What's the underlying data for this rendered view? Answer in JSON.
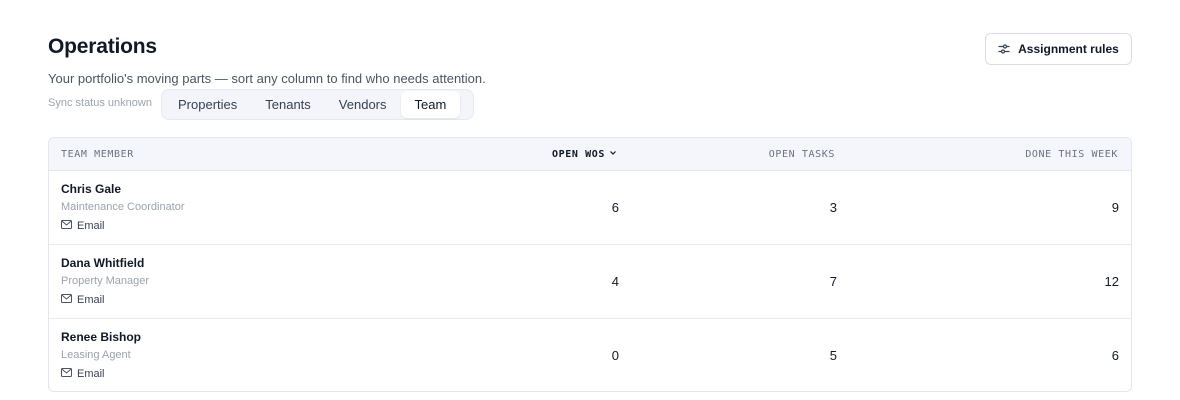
{
  "header": {
    "title": "Operations",
    "subtitle": "Your portfolio's moving parts — sort any column to find who needs attention.",
    "sync_status": "Sync status unknown",
    "rules_button": "Assignment rules",
    "rules_icon": "sliders-icon"
  },
  "tabs": [
    {
      "label": "Properties",
      "active": false
    },
    {
      "label": "Tenants",
      "active": false
    },
    {
      "label": "Vendors",
      "active": false
    },
    {
      "label": "Team",
      "active": true
    }
  ],
  "table": {
    "columns": {
      "member": "TEAM MEMBER",
      "open_wos": "OPEN WOS",
      "open_tasks": "OPEN TASKS",
      "done_this_week": "DONE THIS WEEK"
    },
    "sorted_by": "open_wos",
    "rows": [
      {
        "name": "Chris Gale",
        "role": "Maintenance Coordinator",
        "email_label": "Email",
        "open_wos": "6",
        "open_tasks": "3",
        "done_this_week": "9"
      },
      {
        "name": "Dana Whitfield",
        "role": "Property Manager",
        "email_label": "Email",
        "open_wos": "4",
        "open_tasks": "7",
        "done_this_week": "12"
      },
      {
        "name": "Renee Bishop",
        "role": "Leasing Agent",
        "email_label": "Email",
        "open_wos": "0",
        "open_tasks": "5",
        "done_this_week": "6"
      }
    ]
  }
}
